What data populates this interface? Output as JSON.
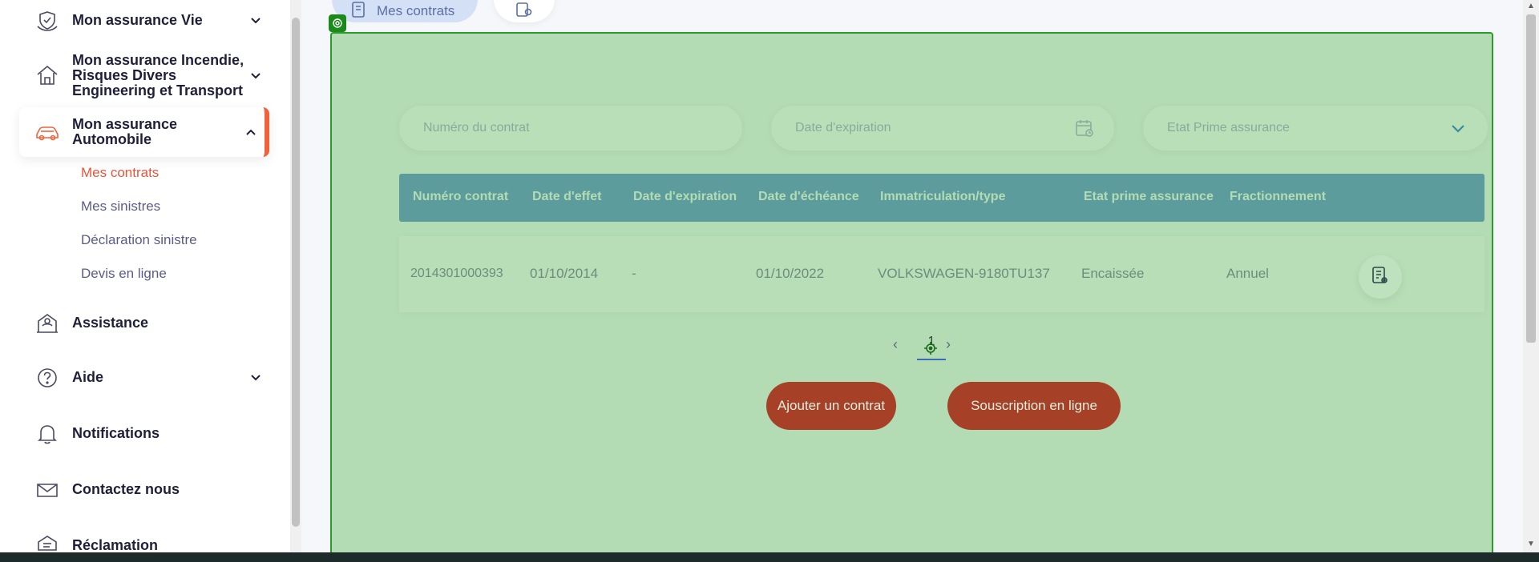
{
  "sidebar": {
    "items": [
      {
        "label": "Mon assurance Vie",
        "icon": "life-insurance-icon",
        "expandable": true
      },
      {
        "label": "Mon assurance Incendie, Risques Divers Engineering et Transport",
        "icon": "home-icon",
        "expandable": true
      },
      {
        "label": "Mon assurance Automobile",
        "icon": "car-icon",
        "expandable": true,
        "expanded": true
      },
      {
        "label": "Assistance",
        "icon": "assistance-icon"
      },
      {
        "label": "Aide",
        "icon": "help-icon",
        "expandable": true
      },
      {
        "label": "Notifications",
        "icon": "bell-icon"
      },
      {
        "label": "Contactez nous",
        "icon": "mail-icon"
      },
      {
        "label": "Réclamation",
        "icon": "complaint-icon"
      }
    ],
    "sub_items": [
      {
        "label": "Mes contrats",
        "active": true
      },
      {
        "label": "Mes sinistres"
      },
      {
        "label": "Déclaration sinistre"
      },
      {
        "label": "Devis en ligne"
      }
    ]
  },
  "tabs": {
    "active_label": "Mes contrats"
  },
  "filters": {
    "contract_number_placeholder": "Numéro du contrat",
    "expiry_date_placeholder": "Date d'expiration",
    "premium_state_placeholder": "Etat Prime assurance"
  },
  "table": {
    "headers": [
      "Numéro contrat",
      "Date d'effet",
      "Date d'expiration",
      "Date d'échéance",
      "Immatriculation/type",
      "Etat prime assurance",
      "Fractionnement"
    ],
    "rows": [
      [
        "2014301000393",
        "01/10/2014",
        "-",
        "01/10/2022",
        "VOLKSWAGEN-9180TU137",
        "Encaissée",
        "Annuel"
      ]
    ]
  },
  "pagination": {
    "current_page": "1",
    "prev": "‹",
    "next": "›"
  },
  "actions": {
    "add_contract": "Ajouter un contrat",
    "online_subscription": "Souscription en ligne"
  },
  "colors": {
    "accent": "#f2623a",
    "overlay": "#b4dcb4",
    "overlay_border": "#2a9a2a",
    "button": "#a64026",
    "table_header": "#5c9c9c"
  }
}
